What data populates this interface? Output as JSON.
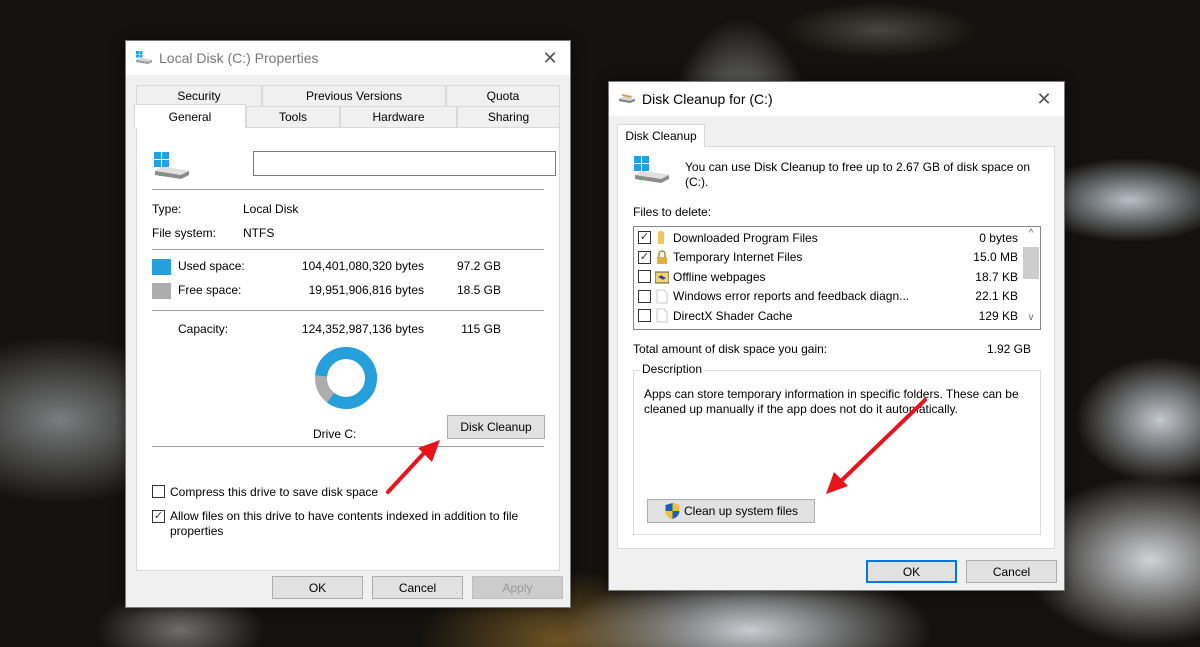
{
  "properties_dialog": {
    "title": "Local Disk (C:) Properties",
    "close_glyph": "✕",
    "tabs_row1": [
      {
        "label": "Security"
      },
      {
        "label": "Previous Versions"
      },
      {
        "label": "Quota"
      }
    ],
    "tabs_row2": [
      {
        "label": "General",
        "active": true
      },
      {
        "label": "Tools"
      },
      {
        "label": "Hardware"
      },
      {
        "label": "Sharing"
      }
    ],
    "drive_name_value": "",
    "type_label": "Type:",
    "type_value": "Local Disk",
    "fs_label": "File system:",
    "fs_value": "NTFS",
    "used": {
      "label": "Used space:",
      "bytes": "104,401,080,320 bytes",
      "size": "97.2 GB",
      "color": "#26a0da"
    },
    "free": {
      "label": "Free space:",
      "bytes": "19,951,906,816 bytes",
      "size": "18.5 GB",
      "color": "#adadad"
    },
    "capacity": {
      "label": "Capacity:",
      "bytes": "124,352,987,136 bytes",
      "size": "115 GB"
    },
    "used_fraction": 0.8396,
    "drive_label": "Drive C:",
    "disk_cleanup_label": "Disk Cleanup",
    "compress_label": "Compress this drive to save disk space",
    "compress_checked": false,
    "index_label": "Allow files on this drive to have contents indexed in addition to file properties",
    "index_checked": true,
    "ok_label": "OK",
    "cancel_label": "Cancel",
    "apply_label": "Apply"
  },
  "cleanup_dialog": {
    "title": "Disk Cleanup for  (C:)",
    "close_glyph": "✕",
    "tab_label": "Disk Cleanup",
    "intro_text": "You can use Disk Cleanup to free up to 2.67 GB of disk space on (C:).",
    "files_to_delete_label": "Files to delete:",
    "files": [
      {
        "name": "Downloaded Program Files",
        "size": "0 bytes",
        "checked": true,
        "icon": "folder-icon"
      },
      {
        "name": "Temporary Internet Files",
        "size": "15.0 MB",
        "checked": true,
        "icon": "lock-icon"
      },
      {
        "name": "Offline webpages",
        "size": "18.7 KB",
        "checked": false,
        "icon": "sync-folder-icon"
      },
      {
        "name": "Windows error reports and feedback diagn...",
        "size": "22.1 KB",
        "checked": false,
        "icon": "document-icon"
      },
      {
        "name": "DirectX Shader Cache",
        "size": "129 KB",
        "checked": false,
        "icon": "document-icon"
      }
    ],
    "scroll_up_glyph": "^",
    "scroll_down_glyph": "v",
    "total_label": "Total amount of disk space you gain:",
    "total_value": "1.92 GB",
    "description_legend": "Description",
    "description_text": "Apps can store temporary information in specific folders. These can be cleaned up manually if the app does not do it automatically.",
    "cleanup_system_label": "Clean up system files",
    "ok_label": "OK",
    "cancel_label": "Cancel"
  },
  "annotations": {
    "arrow_color": "#e8141b"
  }
}
